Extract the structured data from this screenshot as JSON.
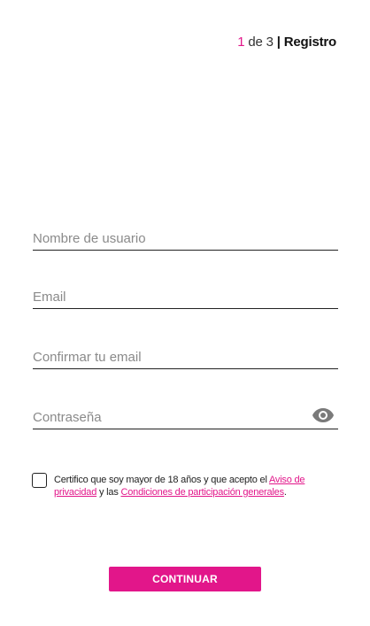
{
  "step": {
    "current": "1",
    "of": "de",
    "total": "3",
    "separator": "|",
    "title": "Registro"
  },
  "form": {
    "username_placeholder": "Nombre de usuario",
    "email_placeholder": "Email",
    "confirm_email_placeholder": "Confirmar tu email",
    "password_placeholder": "Contraseña"
  },
  "terms": {
    "text_before": "Certifico que soy mayor de 18 años y que acepto el ",
    "privacy_link": "Aviso de privacidad",
    "text_middle": " y las ",
    "conditions_link": "Condiciones de participación generales",
    "text_after": ".",
    "checked": false
  },
  "actions": {
    "continue_label": "CONTINUAR"
  },
  "colors": {
    "accent": "#e2168a",
    "text": "#222222",
    "placeholder": "#8a8a8a",
    "icon": "#7a7a7a"
  },
  "icons": {
    "password_toggle": "eye-icon"
  }
}
